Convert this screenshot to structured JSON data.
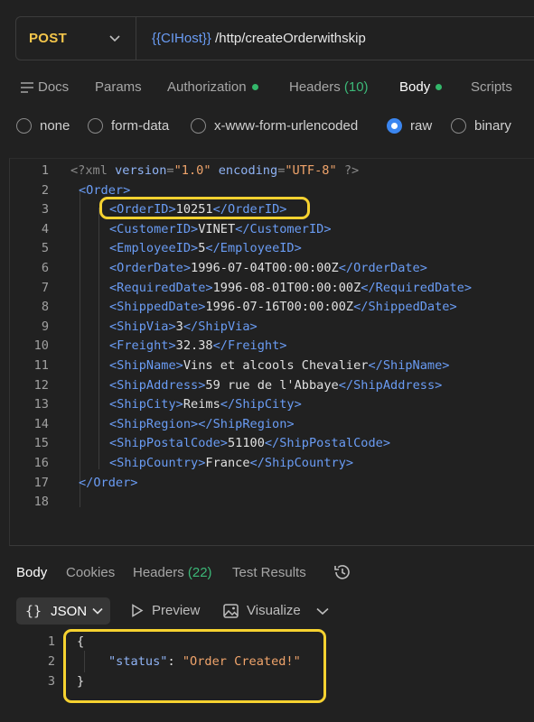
{
  "request": {
    "method": "POST",
    "url_variable": "{{CIHost}}",
    "url_path": " /http/createOrderwithskip"
  },
  "request_tabs": [
    {
      "label": "Docs"
    },
    {
      "label": "Params"
    },
    {
      "label": "Authorization"
    },
    {
      "label": "Headers",
      "count": "(10)"
    },
    {
      "label": "Body"
    },
    {
      "label": "Scripts"
    }
  ],
  "body_types": [
    "none",
    "form-data",
    "x-www-form-urlencoded",
    "raw",
    "binary"
  ],
  "selected_body_type": "raw",
  "editor": {
    "line_numbers": [
      "1",
      "2",
      "3",
      "4",
      "5",
      "6",
      "7",
      "8",
      "9",
      "10",
      "11",
      "12",
      "13",
      "14",
      "15",
      "16",
      "17",
      "18"
    ],
    "xml_declaration": {
      "open": "<?xml ",
      "version_attr": "version",
      "version_val": "\"1.0\"",
      "encoding_attr": "encoding",
      "encoding_val": "\"UTF-8\"",
      "close": " ?>"
    },
    "root_tag": "Order",
    "fields": [
      {
        "tag": "OrderID",
        "value": "10251"
      },
      {
        "tag": "CustomerID",
        "value": "VINET"
      },
      {
        "tag": "EmployeeID",
        "value": "5"
      },
      {
        "tag": "OrderDate",
        "value": "1996-07-04T00:00:00Z"
      },
      {
        "tag": "RequiredDate",
        "value": "1996-08-01T00:00:00Z"
      },
      {
        "tag": "ShippedDate",
        "value": "1996-07-16T00:00:00Z"
      },
      {
        "tag": "ShipVia",
        "value": "3"
      },
      {
        "tag": "Freight",
        "value": "32.38"
      },
      {
        "tag": "ShipName",
        "value": "Vins et alcools Chevalier"
      },
      {
        "tag": "ShipAddress",
        "value": "59 rue de l'Abbaye"
      },
      {
        "tag": "ShipCity",
        "value": "Reims"
      },
      {
        "tag": "ShipRegion",
        "value": ""
      },
      {
        "tag": "ShipPostalCode",
        "value": "51100"
      },
      {
        "tag": "ShipCountry",
        "value": "France"
      }
    ]
  },
  "response_tabs": [
    {
      "label": "Body"
    },
    {
      "label": "Cookies"
    },
    {
      "label": "Headers",
      "count": "(22)"
    },
    {
      "label": "Test Results"
    }
  ],
  "response_toolbar": {
    "format_braces": "{}",
    "format": "JSON",
    "preview": "Preview",
    "visualize": "Visualize"
  },
  "response": {
    "line_numbers": [
      "1",
      "2",
      "3"
    ],
    "open_brace": "{",
    "key": "\"status\"",
    "separator": ": ",
    "value": "\"Order Created!\"",
    "close_brace": "}"
  },
  "colors": {
    "method": "#f4c64b",
    "variable": "#6a9cf4",
    "xml_tag": "#6a9cf4",
    "string": "#f0a46b",
    "status_dot": "#33b76a",
    "count": "#3cb878",
    "radio_selected": "#3b86f0",
    "highlight": "#f6d230",
    "active_tab_underline": "#ff6c37"
  }
}
